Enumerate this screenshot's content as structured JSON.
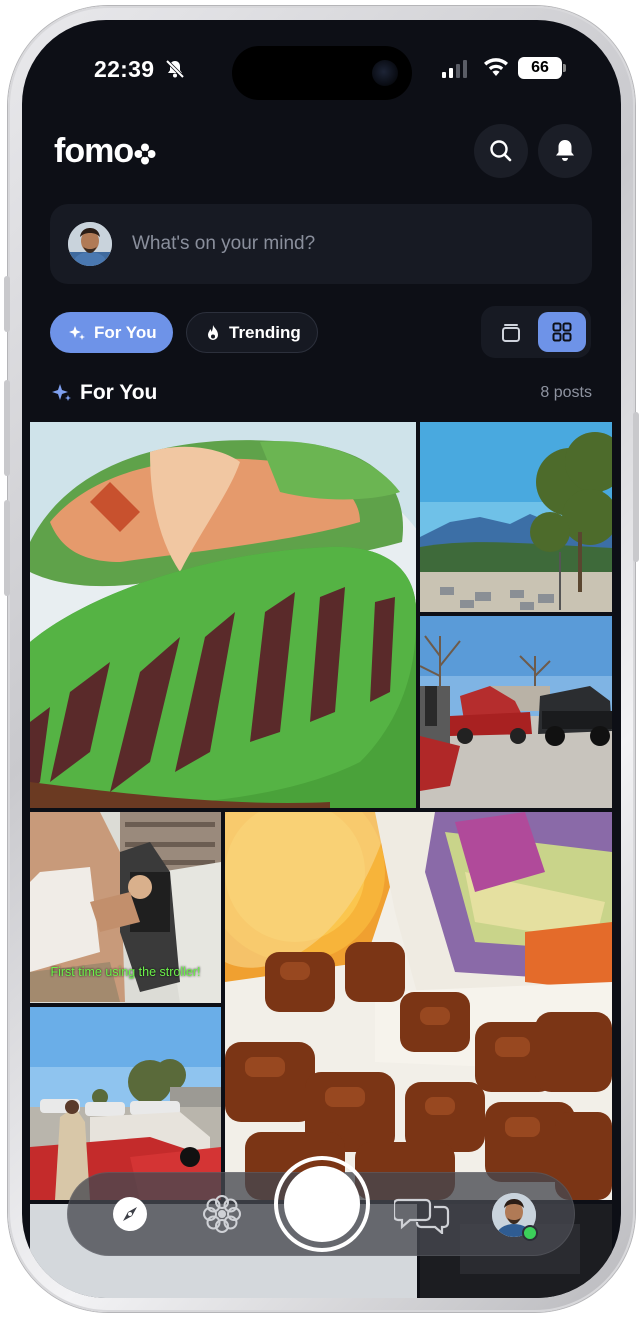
{
  "status_bar": {
    "time": "22:39",
    "battery": "66"
  },
  "header": {
    "logo": "fomo"
  },
  "composer": {
    "placeholder": "What's on your mind?"
  },
  "filters": [
    {
      "label": "For You",
      "active": true
    },
    {
      "label": "Trending",
      "active": false
    }
  ],
  "view_modes": {
    "selected": "grid"
  },
  "section": {
    "title": "For You",
    "count": "8 posts"
  },
  "posts": [
    {
      "id": "post-burrito",
      "caption": ""
    },
    {
      "id": "post-mountains-street",
      "caption": ""
    },
    {
      "id": "post-car-show",
      "caption": ""
    },
    {
      "id": "post-stroller",
      "caption": "First time using the stroller!"
    },
    {
      "id": "post-teriyaki",
      "caption": ""
    },
    {
      "id": "post-classic-cars",
      "caption": ""
    }
  ],
  "colors": {
    "accent": "#6e93e8",
    "background": "#0d0f16",
    "online": "#3ccf5a"
  },
  "dock": {
    "items": [
      "compass-icon",
      "flower-icon",
      "capture-button",
      "chat-icon",
      "profile-avatar"
    ]
  }
}
